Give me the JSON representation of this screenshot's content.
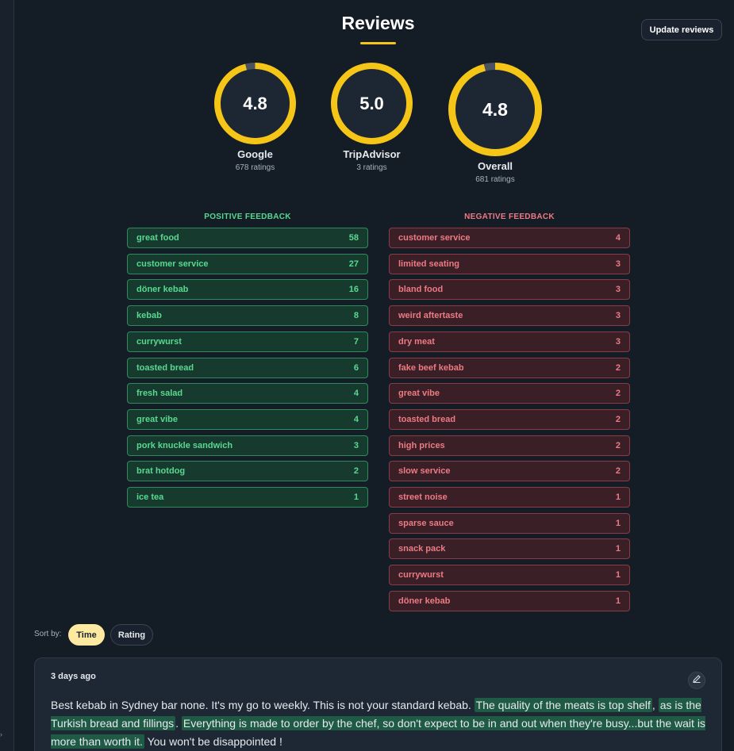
{
  "header": {
    "title": "Reviews",
    "update_button": "Update reviews"
  },
  "ratings": [
    {
      "source": "Google",
      "score": "4.8",
      "count": "678 ratings",
      "fraction": 0.96
    },
    {
      "source": "TripAdvisor",
      "score": "5.0",
      "count": "3 ratings",
      "fraction": 1.0
    },
    {
      "source": "Overall",
      "score": "4.8",
      "count": "681 ratings",
      "fraction": 0.96
    }
  ],
  "positive": {
    "heading": "POSITIVE FEEDBACK",
    "items": [
      {
        "label": "great food",
        "count": "58"
      },
      {
        "label": "customer service",
        "count": "27"
      },
      {
        "label": "döner kebab",
        "count": "16"
      },
      {
        "label": "kebab",
        "count": "8"
      },
      {
        "label": "currywurst",
        "count": "7"
      },
      {
        "label": "toasted bread",
        "count": "6"
      },
      {
        "label": "fresh salad",
        "count": "4"
      },
      {
        "label": "great vibe",
        "count": "4"
      },
      {
        "label": "pork knuckle sandwich",
        "count": "3"
      },
      {
        "label": "brat hotdog",
        "count": "2"
      },
      {
        "label": "ice tea",
        "count": "1"
      }
    ]
  },
  "negative": {
    "heading": "NEGATIVE FEEDBACK",
    "items": [
      {
        "label": "customer service",
        "count": "4"
      },
      {
        "label": "limited seating",
        "count": "3"
      },
      {
        "label": "bland food",
        "count": "3"
      },
      {
        "label": "weird aftertaste",
        "count": "3"
      },
      {
        "label": "dry meat",
        "count": "3"
      },
      {
        "label": "fake beef kebab",
        "count": "2"
      },
      {
        "label": "great vibe",
        "count": "2"
      },
      {
        "label": "toasted bread",
        "count": "2"
      },
      {
        "label": "high prices",
        "count": "2"
      },
      {
        "label": "slow service",
        "count": "2"
      },
      {
        "label": "street noise",
        "count": "1"
      },
      {
        "label": "sparse sauce",
        "count": "1"
      },
      {
        "label": "snack pack",
        "count": "1"
      },
      {
        "label": "currywurst",
        "count": "1"
      },
      {
        "label": "döner kebab",
        "count": "1"
      }
    ]
  },
  "sort": {
    "label": "Sort by:",
    "options": [
      "Time",
      "Rating"
    ],
    "active": "Time"
  },
  "review": {
    "time": "3 days ago",
    "segments": [
      {
        "text": "Best kebab in Sydney bar none. It's my go to weekly. This is not your standard kebab. ",
        "highlight": false
      },
      {
        "text": "The quality of the meats is top shelf",
        "highlight": true
      },
      {
        "text": ", ",
        "highlight": false
      },
      {
        "text": "as is the Turkish bread and fillings",
        "highlight": true
      },
      {
        "text": ". ",
        "highlight": false
      },
      {
        "text": "Everything is made to order by the chef, so don't expect to be in and out when they're busy...but the wait is more than worth it.",
        "highlight": true
      },
      {
        "text": " You won't be disappointed !",
        "highlight": false
      }
    ]
  },
  "icons": {
    "edit": "pencil-icon"
  },
  "colors": {
    "accent": "#f5c518",
    "ring_track": "#4a5260",
    "positive": "#58d98f",
    "negative": "#ee7a84"
  }
}
